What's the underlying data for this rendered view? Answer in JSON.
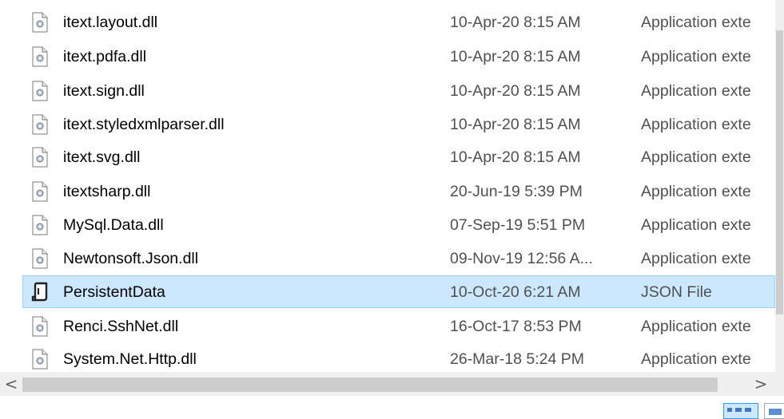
{
  "files": [
    {
      "name": "itext.layout.dll",
      "date": "10-Apr-20 8:15 AM",
      "type": "Application exte",
      "icon": "dll-file-icon"
    },
    {
      "name": "itext.pdfa.dll",
      "date": "10-Apr-20 8:15 AM",
      "type": "Application exte",
      "icon": "dll-file-icon"
    },
    {
      "name": "itext.sign.dll",
      "date": "10-Apr-20 8:15 AM",
      "type": "Application exte",
      "icon": "dll-file-icon"
    },
    {
      "name": "itext.styledxmlparser.dll",
      "date": "10-Apr-20 8:15 AM",
      "type": "Application exte",
      "icon": "dll-file-icon"
    },
    {
      "name": "itext.svg.dll",
      "date": "10-Apr-20 8:15 AM",
      "type": "Application exte",
      "icon": "dll-file-icon"
    },
    {
      "name": "itextsharp.dll",
      "date": "20-Jun-19 5:39 PM",
      "type": "Application exte",
      "icon": "dll-file-icon"
    },
    {
      "name": "MySql.Data.dll",
      "date": "07-Sep-19 5:51 PM",
      "type": "Application exte",
      "icon": "dll-file-icon"
    },
    {
      "name": "Newtonsoft.Json.dll",
      "date": "09-Nov-19 12:56 A...",
      "type": "Application exte",
      "icon": "dll-file-icon"
    },
    {
      "name": "PersistentData",
      "date": "10-Oct-20 6:21 AM",
      "type": "JSON File",
      "icon": "json-file-icon",
      "selected": true
    },
    {
      "name": "Renci.SshNet.dll",
      "date": "16-Oct-17 8:53 PM",
      "type": "Application exte",
      "icon": "dll-file-icon"
    },
    {
      "name": "System.Net.Http.dll",
      "date": "26-Mar-18 5:24 PM",
      "type": "Application exte",
      "icon": "dll-file-icon"
    }
  ],
  "scrollbar": {
    "left_arrow": "<",
    "right_arrow": ">"
  },
  "colors": {
    "selection_bg": "#cce8ff",
    "selection_border": "#99d1ff",
    "secondary_text": "#505050"
  }
}
